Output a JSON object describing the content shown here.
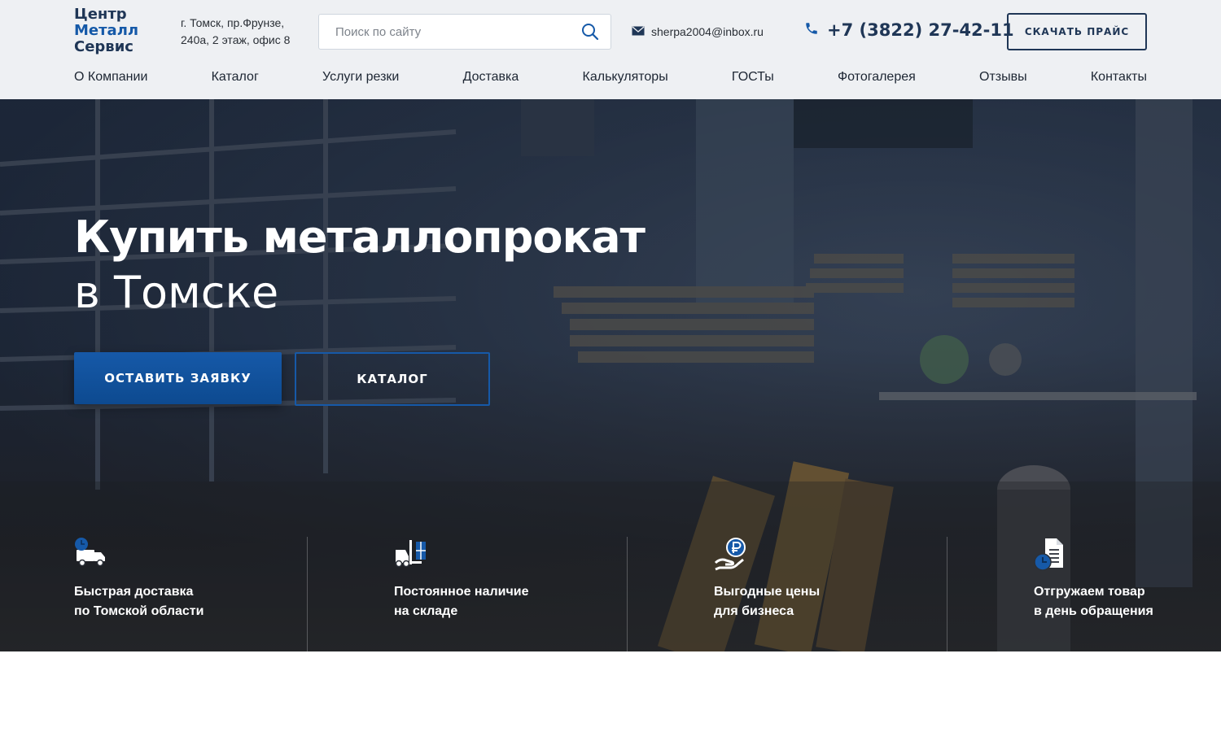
{
  "header": {
    "logo": {
      "line1": "Центр",
      "line2": "Металл",
      "line3": "Сервис"
    },
    "address": {
      "line1": "г. Томск, пр.Фрунзе,",
      "line2": "240а, 2 этаж, офис 8"
    },
    "search": {
      "placeholder": "Поиск по сайту",
      "value": ""
    },
    "email": "sherpa2004@inbox.ru",
    "phone": "+7 (3822) 27-42-11",
    "price_button": "СКАЧАТЬ ПРАЙС"
  },
  "nav": [
    "О Компании",
    "Каталог",
    "Услуги резки",
    "Доставка",
    "Калькуляторы",
    "ГОСТы",
    "Фотогалерея",
    "Отзывы",
    "Контакты"
  ],
  "hero": {
    "title_line1": "Купить металлопрокат",
    "title_line2": "в Томске",
    "order_button": "ОСТАВИТЬ ЗАЯВКУ",
    "catalog_button": "КАТАЛОГ"
  },
  "features": [
    {
      "icon": "truck-icon",
      "line1": "Быстрая доставка",
      "line2": "по Томской области"
    },
    {
      "icon": "forklift-icon",
      "line1": "Постоянное наличие",
      "line2": "на складе"
    },
    {
      "icon": "hand-ruble-icon",
      "line1": "Выгодные цены",
      "line2": "для бизнеса"
    },
    {
      "icon": "document-clock-icon",
      "line1": "Отгружаем товар",
      "line2": "в день обращения"
    }
  ],
  "colors": {
    "brand_dark": "#1f3656",
    "brand_blue": "#1659a8",
    "header_bg": "#eef0f3"
  }
}
